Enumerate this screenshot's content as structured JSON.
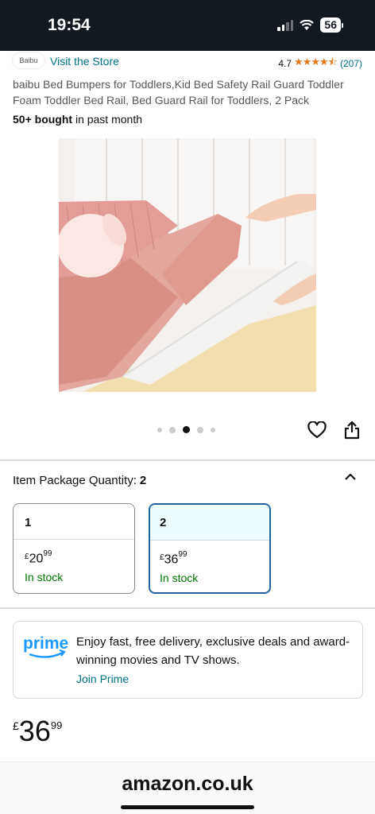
{
  "status_bar": {
    "time": "19:54",
    "battery": "56"
  },
  "store": {
    "brand_logo_text": "Baibu",
    "visit_store": "Visit the Store",
    "rating": "4.7",
    "rating_count": "(207)",
    "stars_filled": 4.5
  },
  "product": {
    "title": "baibu Bed Bumpers for Toddlers,Kid Bed Safety Rail Guard Toddler Foam Toddler Bed Rail, Bed Guard Rail for Toddlers, 2 Pack",
    "bought_bold": "50+ bought",
    "bought_rest": " in past month"
  },
  "carousel": {
    "count": 5,
    "active_index": 2
  },
  "quantity": {
    "label": "Item Package Quantity:",
    "selected": "2",
    "options": [
      {
        "qty": "1",
        "currency": "£",
        "whole": "20",
        "fraction": "99",
        "stock": "In stock"
      },
      {
        "qty": "2",
        "currency": "£",
        "whole": "36",
        "fraction": "99",
        "stock": "In stock"
      }
    ]
  },
  "prime": {
    "logo": "prime",
    "text": "Enjoy fast, free delivery, exclusive deals and award-winning movies and TV shows.",
    "link": "Join Prime"
  },
  "price": {
    "currency": "£",
    "whole": "36",
    "fraction": "99"
  },
  "footer": {
    "domain": "amazon.co.uk"
  },
  "colors": {
    "link": "#007185",
    "star": "#de7921",
    "stock": "#007600",
    "selected_border": "#2162a1",
    "header_bg": "#131921"
  }
}
